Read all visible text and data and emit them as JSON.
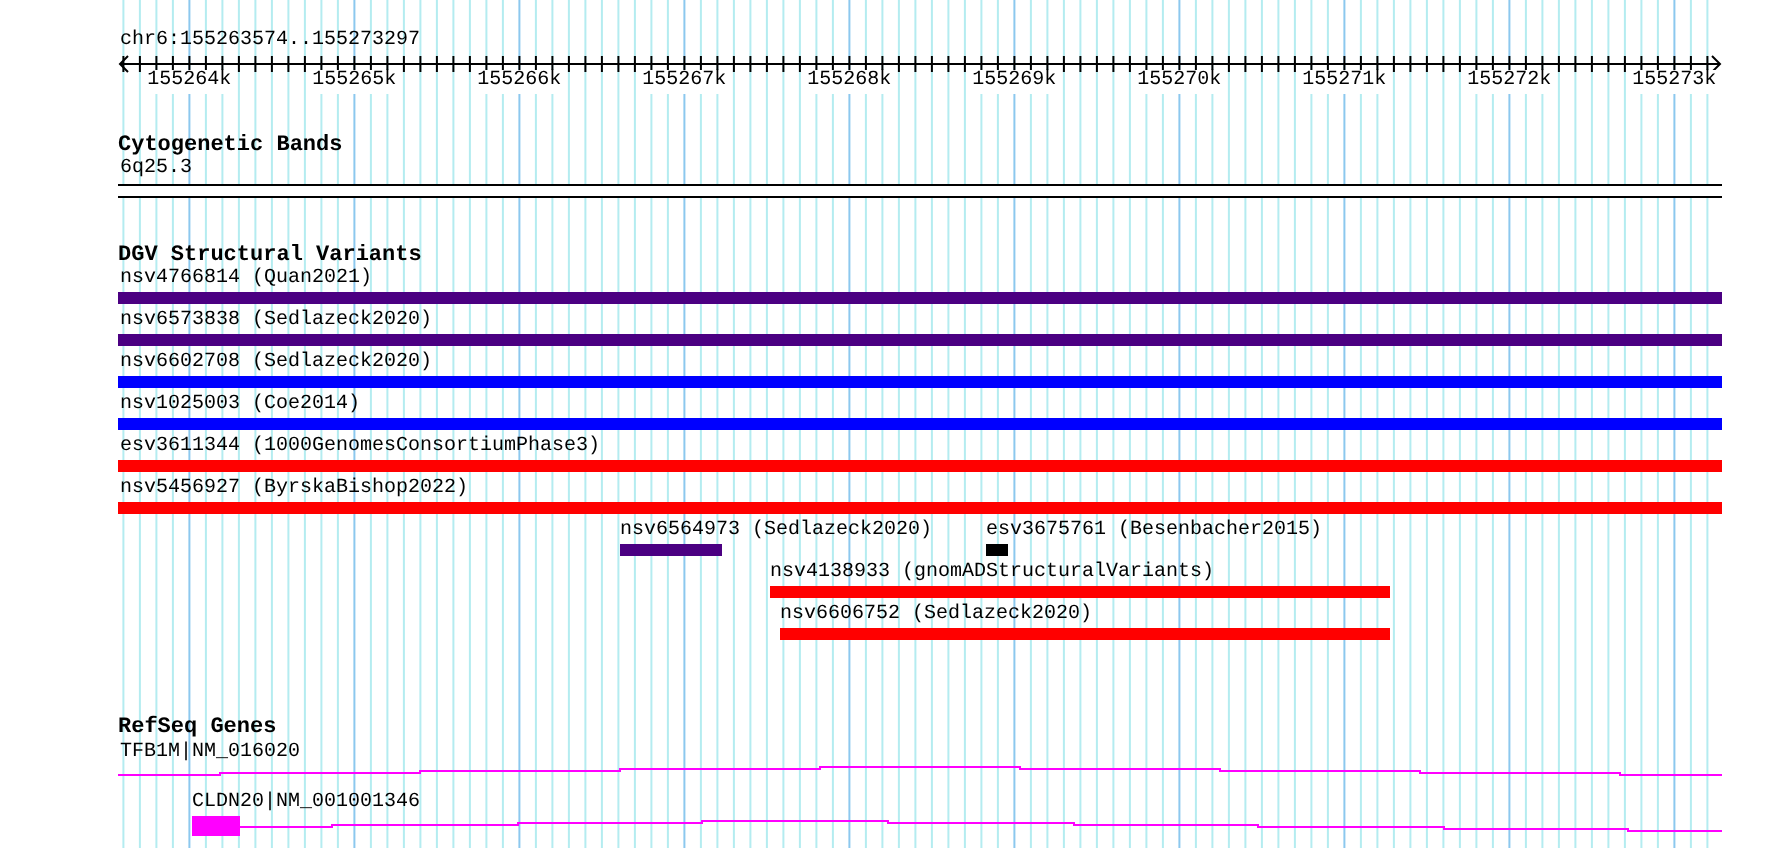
{
  "location": "chr6:155263574..155273297",
  "ruler": {
    "ticks": [
      "155264k",
      "155265k",
      "155266k",
      "155267k",
      "155268k",
      "155269k",
      "155270k",
      "155271k",
      "155272k",
      "155273k"
    ]
  },
  "tracks": [
    {
      "kind": "bands",
      "title": "Cytogenetic Bands",
      "features": [
        {
          "label": "6q25.3"
        }
      ]
    },
    {
      "kind": "variants",
      "title": "DGV Structural Variants",
      "features": [
        {
          "label": "nsv4766814 (Quan2021)",
          "color": "#4b0082"
        },
        {
          "label": "nsv6573838 (Sedlazeck2020)",
          "color": "#4b0082"
        },
        {
          "label": "nsv6602708 (Sedlazeck2020)",
          "color": "#0000ff"
        },
        {
          "label": "nsv1025003 (Coe2014)",
          "color": "#0000ff"
        },
        {
          "label": "esv3611344 (1000GenomesConsortiumPhase3)",
          "color": "#ff0000"
        },
        {
          "label": "nsv5456927 (ByrskaBishop2022)",
          "color": "#ff0000"
        },
        {
          "label": "nsv6564973 (Sedlazeck2020)",
          "color": "#4b0082"
        },
        {
          "label": "esv3675761 (Besenbacher2015)",
          "color": "#000000"
        },
        {
          "label": "nsv4138933 (gnomADStructuralVariants)",
          "color": "#ff0000"
        },
        {
          "label": "nsv6606752 (Sedlazeck2020)",
          "color": "#ff0000"
        }
      ]
    },
    {
      "kind": "genes",
      "title": "RefSeq Genes",
      "features": [
        {
          "label": "TFB1M|NM_016020"
        },
        {
          "label": "CLDN20|NM_001001346"
        }
      ]
    }
  ]
}
